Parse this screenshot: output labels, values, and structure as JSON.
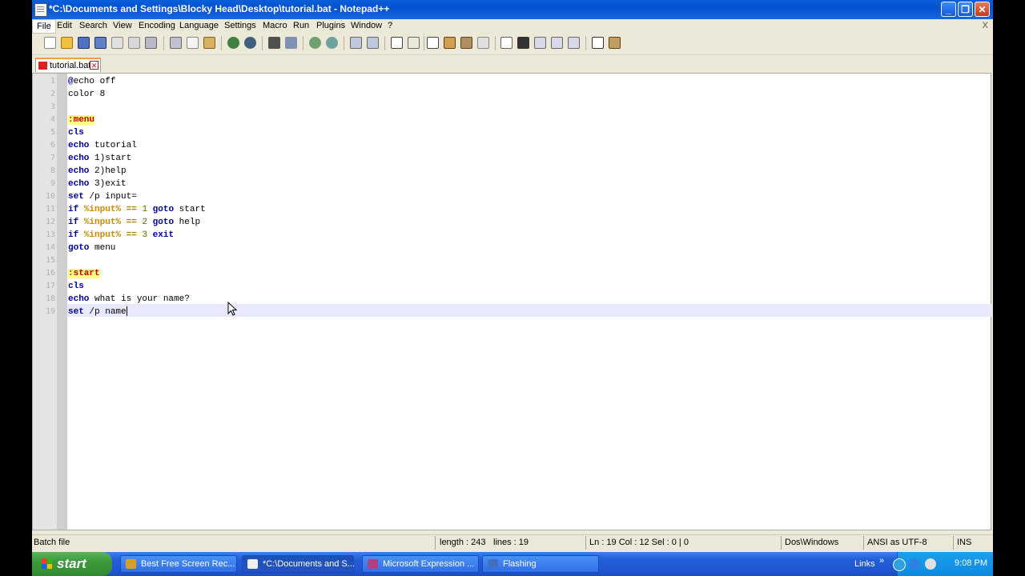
{
  "window": {
    "title": "*C:\\Documents and Settings\\Blocky Head\\Desktop\\tutorial.bat - Notepad++",
    "minimize": "_",
    "maximize": "❐",
    "close": "✕"
  },
  "menu": {
    "items": [
      "File",
      "Edit",
      "Search",
      "View",
      "Encoding",
      "Language",
      "Settings",
      "Macro",
      "Run",
      "Plugins",
      "Window",
      "?"
    ],
    "close_doc": "X"
  },
  "tab": {
    "name": "tutorial.bat",
    "close": "✕"
  },
  "editor": {
    "line_numbers": [
      "1",
      "2",
      "3",
      "4",
      "5",
      "6",
      "7",
      "8",
      "9",
      "10",
      "11",
      "12",
      "13",
      "14",
      "15",
      "16",
      "17",
      "18",
      "19"
    ],
    "lines": [
      [
        [
          "kw",
          "@"
        ],
        [
          "txt",
          "echo off"
        ]
      ],
      [
        [
          "txt",
          "color 8"
        ]
      ],
      [],
      [
        [
          "lbl",
          ":menu"
        ]
      ],
      [
        [
          "kw",
          "cls"
        ]
      ],
      [
        [
          "kw",
          "echo"
        ],
        [
          "txt",
          " tutorial"
        ]
      ],
      [
        [
          "kw",
          "echo"
        ],
        [
          "txt",
          " 1)start"
        ]
      ],
      [
        [
          "kw",
          "echo"
        ],
        [
          "txt",
          " 2)help"
        ]
      ],
      [
        [
          "kw",
          "echo"
        ],
        [
          "txt",
          " 3)exit"
        ]
      ],
      [
        [
          "kw",
          "set"
        ],
        [
          "txt",
          " /p input="
        ]
      ],
      [
        [
          "kw",
          "if"
        ],
        [
          "txt",
          " "
        ],
        [
          "var",
          "%input%"
        ],
        [
          "txt",
          " "
        ],
        [
          "op",
          "=="
        ],
        [
          "txt",
          " "
        ],
        [
          "num",
          "1"
        ],
        [
          "txt",
          " "
        ],
        [
          "kw",
          "goto"
        ],
        [
          "txt",
          " start"
        ]
      ],
      [
        [
          "kw",
          "if"
        ],
        [
          "txt",
          " "
        ],
        [
          "var",
          "%input%"
        ],
        [
          "txt",
          " "
        ],
        [
          "op",
          "=="
        ],
        [
          "txt",
          " "
        ],
        [
          "num",
          "2"
        ],
        [
          "txt",
          " "
        ],
        [
          "kw",
          "goto"
        ],
        [
          "txt",
          " help"
        ]
      ],
      [
        [
          "kw",
          "if"
        ],
        [
          "txt",
          " "
        ],
        [
          "var",
          "%input%"
        ],
        [
          "txt",
          " "
        ],
        [
          "op",
          "=="
        ],
        [
          "txt",
          " "
        ],
        [
          "num",
          "3"
        ],
        [
          "txt",
          " "
        ],
        [
          "kw",
          "exit"
        ]
      ],
      [
        [
          "kw",
          "goto"
        ],
        [
          "txt",
          " menu"
        ]
      ],
      [],
      [
        [
          "lbl",
          ":start"
        ]
      ],
      [
        [
          "kw",
          "cls"
        ]
      ],
      [
        [
          "kw",
          "echo"
        ],
        [
          "txt",
          " what is your name?"
        ]
      ],
      [
        [
          "kw",
          "set"
        ],
        [
          "txt",
          " /p name"
        ]
      ]
    ],
    "current_line": 19
  },
  "status": {
    "file_type": "Batch file",
    "length": "length : 243",
    "lines": "lines : 19",
    "position": "Ln : 19    Col : 12    Sel : 0 | 0",
    "eol": "Dos\\Windows",
    "encoding": "ANSI as UTF-8",
    "mode": "INS"
  },
  "taskbar": {
    "start_label": "start",
    "tasks": [
      {
        "label": "Best Free Screen Rec...",
        "color": "#d8a020"
      },
      {
        "label": "*C:\\Documents and S...",
        "color": "#f0f0f0"
      },
      {
        "label": "Microsoft Expression ...",
        "color": "#b04080"
      },
      {
        "label": "Flashing",
        "color": "#4070c0"
      }
    ],
    "links": "Links",
    "chevron": "»",
    "clock": "9:08 PM"
  },
  "colors": {
    "titlebar": "#0a5fd8",
    "label_bg": "#ffff80",
    "keyword": "#0000a0",
    "variable": "#cc8800"
  }
}
